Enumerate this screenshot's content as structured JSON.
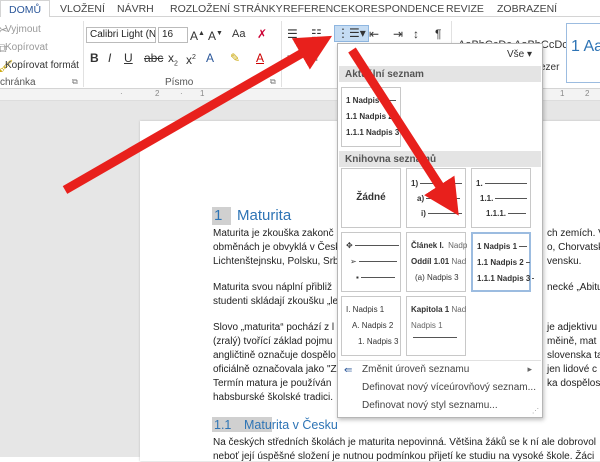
{
  "tabs": [
    "DOMŮ",
    "VLOŽENÍ",
    "NÁVRH",
    "ROZLOŽENÍ STRÁNKY",
    "REFERENCE",
    "KORESPONDENCE",
    "REVIZE",
    "ZOBRAZENÍ"
  ],
  "clipboard": {
    "cut": "Vyjmout",
    "copy": "Kopírovat",
    "format": "Kopírovat formát",
    "label": "chránka"
  },
  "font": {
    "name": "Calibri Light (N",
    "size": "16",
    "label": "Písmo",
    "aa": "Aa"
  },
  "styles": {
    "s1": "AaBbCcDc",
    "s2": "AaBbCcDc",
    "s3": "1 Aa",
    "s3b": "ezer"
  },
  "ruler": [
    "2",
    "1",
    "1",
    "2"
  ],
  "doc": {
    "h1_num": "1",
    "h1": "Maturita",
    "p1": [
      "Maturita je zkouška zakonč",
      "obměnách je obvyklá v Česk",
      "Lichtenštejnsku, Polsku, Srb"
    ],
    "p1r": [
      "ch zemích. V",
      "o, Chorvatsku",
      "vensku."
    ],
    "p2": [
      "Maturita svou náplní přibliž",
      "studenti skládají zkoušku „le"
    ],
    "p2r": [
      "necké „Abitu",
      ""
    ],
    "p3": [
      "Slovo „maturita“ pochází z l",
      "(zralý) tvořící základ pojmu",
      "angličtině označuje dospělo",
      "oficiálně označovala jako \"Z",
      "Termín matura je používán",
      "habsburské školské tradici."
    ],
    "p3r": [
      "je adjektivu",
      "měině, mat",
      "slovenska ta",
      "jen lidové c",
      "ka dospělost",
      ""
    ],
    "h2_num": "1.1",
    "h2": "Maturita v Česku",
    "p4": [
      "Na českých středních školách je maturita nepovinná. Většina žáků se k ní ale dobrovol",
      "neboť její úspěšné složení je nutnou podmínkou přijetí ke studiu na vysoké škole. Žáci"
    ]
  },
  "gallery": {
    "all": "Vše",
    "current_header": "Aktuální seznam",
    "library_header": "Knihovna seznamů",
    "none": "Žádné",
    "current": [
      "1 Nadpis 1",
      "1.1 Nadpis 2",
      "1.1.1 Nadpis 3"
    ],
    "num1": [
      "1)",
      "a)",
      "i)"
    ],
    "num2": [
      "1.",
      "1.1.",
      "1.1.1."
    ],
    "art": [
      "Článek I.",
      "Oddíl 1.01",
      "(a) Nadpis 3"
    ],
    "art_r": [
      "Nadp",
      "Nad",
      ""
    ],
    "head": [
      "1 Nadpis 1",
      "1.1 Nadpis 2",
      "1.1.1 Nadpis 3"
    ],
    "roman": [
      "I. Nadpis 1",
      "A. Nadpis 2",
      "1. Nadpis 3"
    ],
    "chap": [
      "Kapitola 1",
      "Nadpis 1",
      ""
    ],
    "chap_r": [
      "Nad",
      "",
      ""
    ],
    "change_level": "Změnit úroveň seznamu",
    "define_list": "Definovat nový víceúrovňový seznam...",
    "define_style": "Definovat nový styl seznamu...",
    "arrow_color": "#e8201c"
  }
}
